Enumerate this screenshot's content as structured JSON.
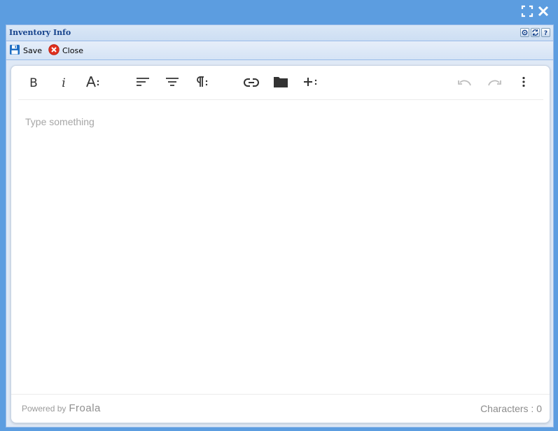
{
  "window": {
    "title": "Inventory Info"
  },
  "toolbar": {
    "save_label": "Save",
    "close_label": "Close"
  },
  "editor": {
    "buttons": {
      "bold": "B",
      "italic": "i"
    },
    "placeholder": "Type something",
    "powered_by": "Powered by",
    "brand": "Froala",
    "char_label": "Characters : 0"
  },
  "icons": {
    "maximize": "maximize-icon",
    "close": "close-icon",
    "save": "floppy-disk-icon",
    "close_button": "close-circle-icon"
  },
  "colors": {
    "background": "#5c9de0",
    "title": "#15428b",
    "close_red": "#e0301e",
    "save_blue": "#1f6fc4"
  }
}
